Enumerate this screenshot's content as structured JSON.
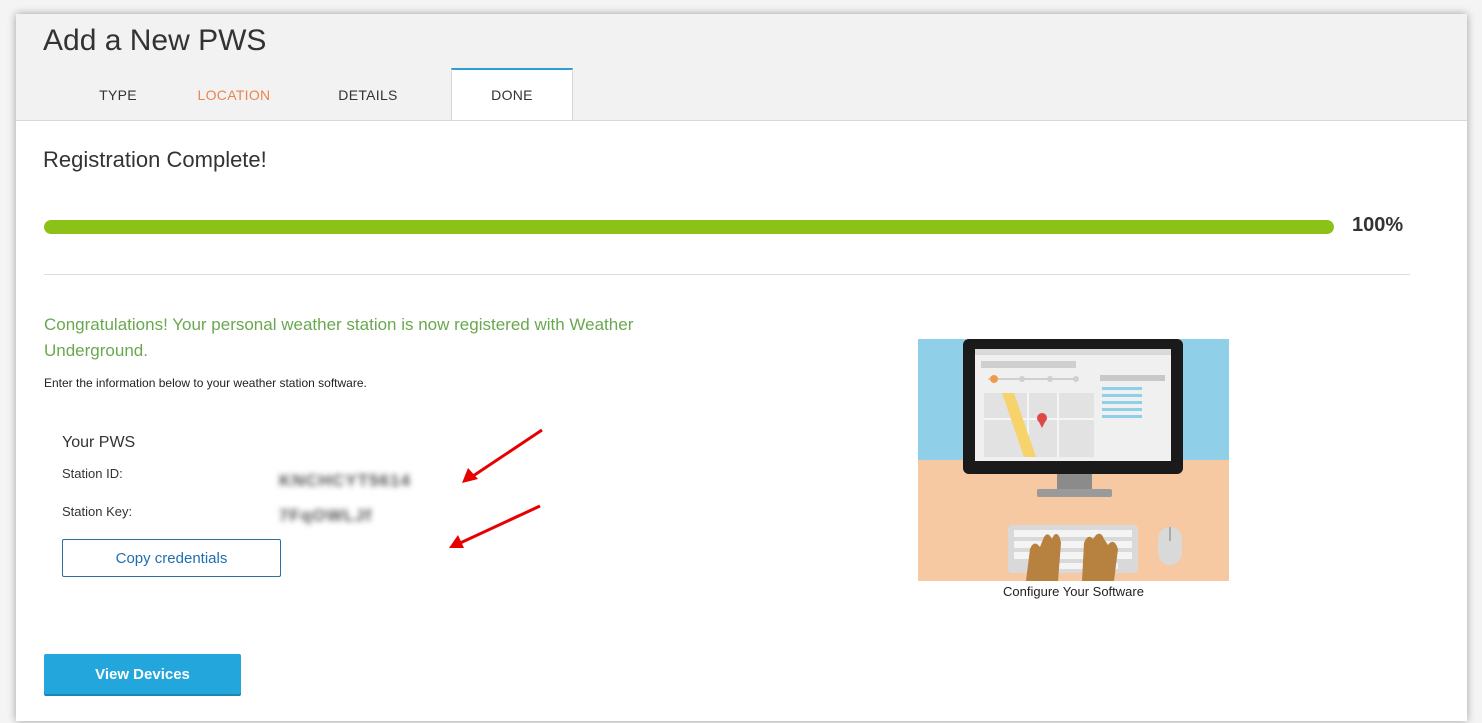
{
  "header": {
    "title": "Add a New PWS",
    "tabs": [
      {
        "label": "TYPE",
        "color": "#333333"
      },
      {
        "label": "LOCATION",
        "color": "#e8874f"
      },
      {
        "label": "DETAILS",
        "color": "#333333"
      },
      {
        "label": "DONE",
        "color": "#333333",
        "active": true
      }
    ]
  },
  "main": {
    "title": "Registration Complete!",
    "progress": {
      "value": 1.0,
      "label": "100%",
      "color": "#8cc217"
    },
    "congrats": "Congratulations! Your personal weather station is now registered with Weather Underground.",
    "instruction": "Enter the information below to your weather station software.",
    "pws": {
      "title": "Your PWS",
      "station_id_label": "Station ID:",
      "station_id_value": "KNCHCYT5614",
      "station_key_label": "Station Key:",
      "station_key_value": "7FqOWLJf"
    },
    "copy_button": "Copy credentials",
    "view_button": "View Devices",
    "illustration_caption": "Configure Your Software"
  },
  "colors": {
    "accent": "#2c9fd1",
    "congrats_text": "#6aa84f",
    "annotation_arrow": "#e60000"
  }
}
